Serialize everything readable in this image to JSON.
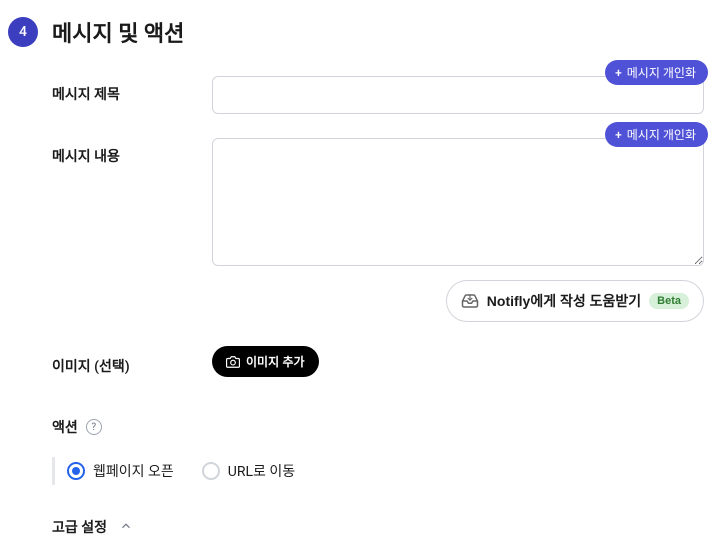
{
  "step": {
    "number": "4",
    "title": "메시지 및 액션"
  },
  "fields": {
    "titleLabel": "메시지 제목",
    "titleValue": "",
    "contentLabel": "메시지 내용",
    "contentValue": "",
    "imageLabel": "이미지 (선택)",
    "actionLabel": "액션",
    "advancedLabel": "고급 설정"
  },
  "buttons": {
    "personalize": "메시지 개인화",
    "help": "Notifly에게 작성 도움받기",
    "helpBadge": "Beta",
    "addImage": "이미지 추가"
  },
  "radios": {
    "option1": "웹페이지 오픈",
    "option2": "URL로 이동"
  }
}
